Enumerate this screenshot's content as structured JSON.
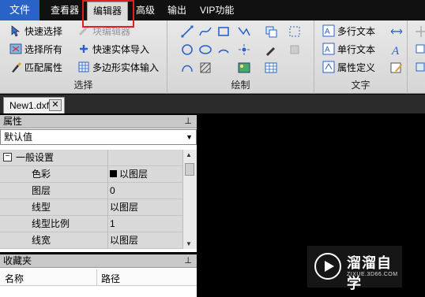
{
  "menu": {
    "file": "文件",
    "items": [
      "查看器",
      "编辑器",
      "高级",
      "输出",
      "VIP功能"
    ]
  },
  "ribbon": {
    "select_group": {
      "label": "选择",
      "quick_select": "快速选择",
      "block_editor": "块编辑器",
      "select_all": "选择所有",
      "quick_entity_import": "快速实体导入",
      "match_properties": "匹配属性",
      "polygon_entity_input": "多边形实体输入"
    },
    "draw_group": {
      "label": "绘制"
    },
    "text_group": {
      "label": "文字",
      "mtext": "多行文本",
      "stext": "单行文本",
      "attdef": "属性定义"
    }
  },
  "doc_tab": {
    "name": "New1.dxf",
    "close": "✕"
  },
  "properties": {
    "title": "属性",
    "pin": "📌",
    "selector": "默认值",
    "section": "一般设置",
    "rows": [
      {
        "key": "色彩",
        "value": "以图层"
      },
      {
        "key": "图层",
        "value": "0"
      },
      {
        "key": "线型",
        "value": "以图层"
      },
      {
        "key": "线型比例",
        "value": "1"
      },
      {
        "key": "线宽",
        "value": "以图层"
      }
    ]
  },
  "favorites": {
    "title": "收藏夹",
    "col_name": "名称",
    "col_path": "路径"
  },
  "watermark": {
    "title": "溜溜自学",
    "url": "ZIXUE.3D66.COM"
  },
  "colors": {
    "accent": "#2a63c8",
    "highlight_box": "#e02020",
    "canvas": "#000000"
  }
}
